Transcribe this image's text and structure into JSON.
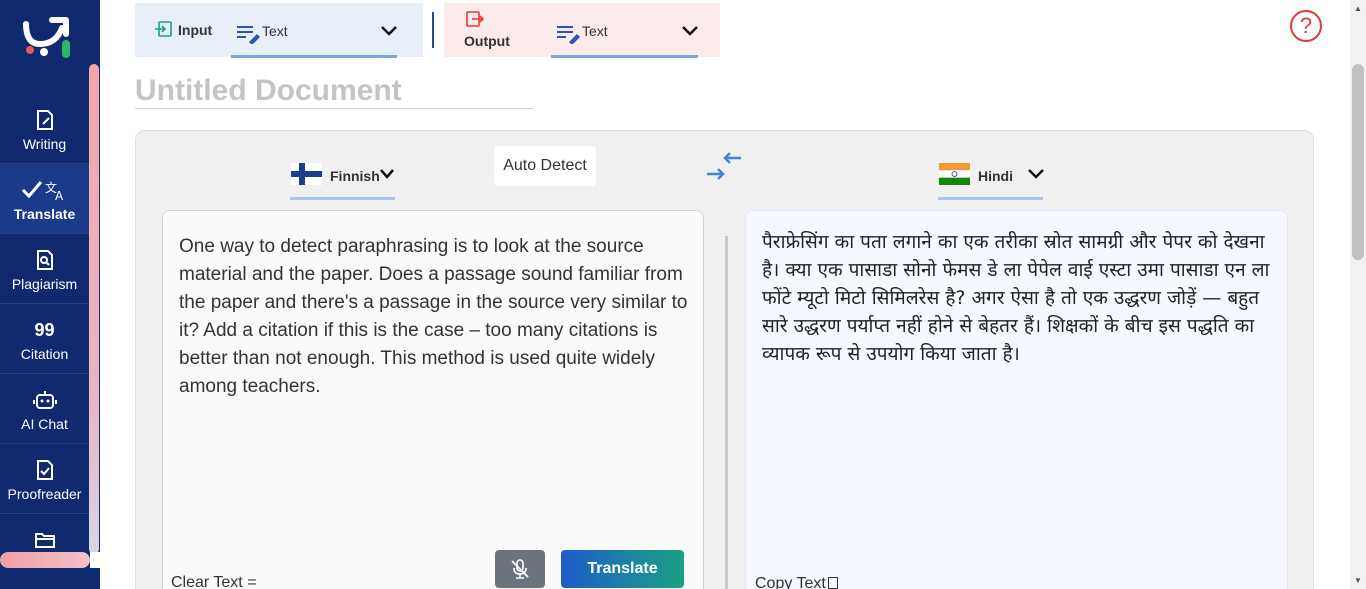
{
  "sidebar": {
    "items": [
      {
        "label": "Writing",
        "icon": "writing-icon"
      },
      {
        "label": "Translate",
        "icon": "translate-icon",
        "active": true
      },
      {
        "label": "Plagiarism",
        "icon": "plagiarism-icon"
      },
      {
        "label": "Citation",
        "icon": "citation-icon",
        "glyph": "99"
      },
      {
        "label": "AI Chat",
        "icon": "robot-icon"
      },
      {
        "label": "Proofreader",
        "icon": "proofreader-icon"
      },
      {
        "label": "",
        "icon": "folder-icon"
      }
    ]
  },
  "header": {
    "input_label": "Input",
    "input_type": "Text",
    "output_label": "Output",
    "output_type": "Text"
  },
  "document": {
    "title": "Untitled Document"
  },
  "translator": {
    "source_language": "Finnish",
    "auto_detect_label": "Auto Detect",
    "target_language": "Hindi",
    "input_text": "One way to detect paraphrasing is to look at the source material and the paper. Does a passage sound familiar from the paper and there's a passage in the source very similar to it? Add a citation if this is the case – too many citations is better than not enough. This method is used quite widely among teachers.",
    "output_text": "पैराफ्रेसिंग का पता लगाने का एक तरीका स्रोत सामग्री और पेपर को देखना है। क्या एक पासाडा सोनो फेमस डे ला पेपेल वाई एस्टा उमा पासाडा एन ला फोंटे म्यूटो मिटो सिमिलरेस है? अगर ऐसा है तो एक उद्धरण जोड़ें — बहुत सारे उद्धरण पर्याप्त नहीं होने से बेहतर हैं। शिक्षकों के बीच इस पद्धति का व्यापक रूप से उपयोग किया जाता है।",
    "translate_button": "Translate",
    "clear_text": "Clear Text",
    "copy_text": "Copy Text"
  },
  "colors": {
    "sidebar_bg": "#0f2a6e",
    "accent_blue": "#1f5cc9",
    "accent_green": "#1aa183",
    "help_red": "#e03b3b"
  }
}
